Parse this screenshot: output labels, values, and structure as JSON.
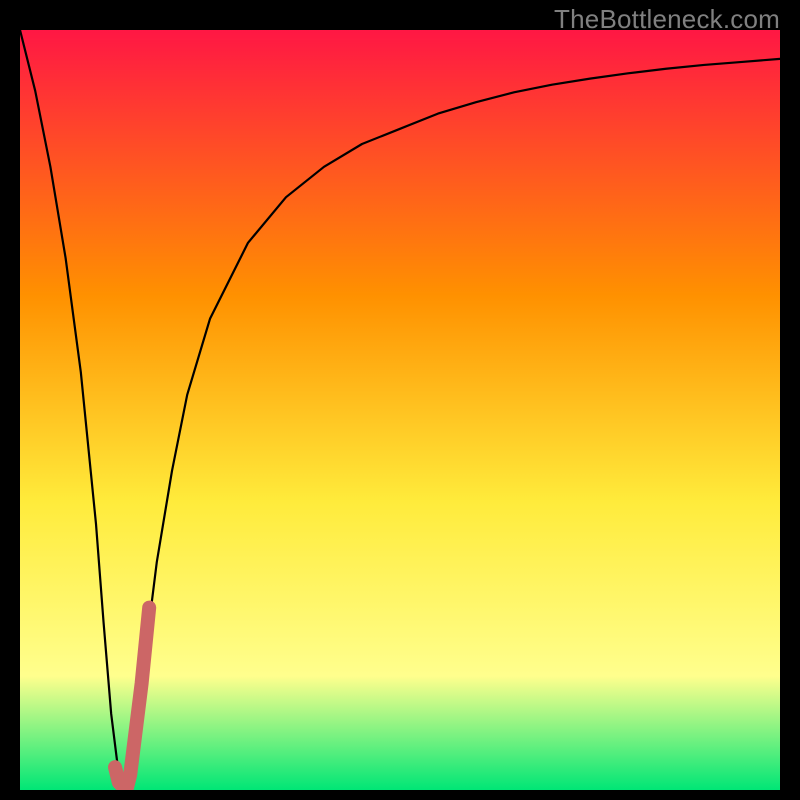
{
  "watermark": "TheBottleneck.com",
  "colors": {
    "gradient_top": "#ff1744",
    "gradient_mid_upper": "#ff9100",
    "gradient_mid": "#ffeb3b",
    "gradient_pale": "#ffff8d",
    "gradient_bottom": "#00e676",
    "curve": "#000000",
    "highlight": "#cc6666",
    "frame": "#000000"
  },
  "chart_data": {
    "type": "line",
    "title": "",
    "xlabel": "",
    "ylabel": "",
    "xlim": [
      0,
      100
    ],
    "ylim": [
      0,
      100
    ],
    "series": [
      {
        "name": "bottleneck-curve",
        "x": [
          0,
          2,
          4,
          6,
          8,
          10,
          11,
          12,
          13,
          14,
          15,
          16,
          17,
          18,
          20,
          22,
          25,
          30,
          35,
          40,
          45,
          50,
          55,
          60,
          65,
          70,
          75,
          80,
          85,
          90,
          95,
          100
        ],
        "values": [
          100,
          92,
          82,
          70,
          55,
          35,
          22,
          10,
          2,
          0,
          4,
          12,
          22,
          30,
          42,
          52,
          62,
          72,
          78,
          82,
          85,
          87,
          89,
          90.5,
          91.8,
          92.8,
          93.6,
          94.3,
          94.9,
          95.4,
          95.8,
          96.2
        ]
      },
      {
        "name": "highlight-segment",
        "x": [
          12.5,
          13,
          13.5,
          14,
          14.5,
          15,
          16,
          17
        ],
        "values": [
          3,
          1,
          0.5,
          0,
          2,
          6,
          14,
          24
        ]
      }
    ]
  }
}
